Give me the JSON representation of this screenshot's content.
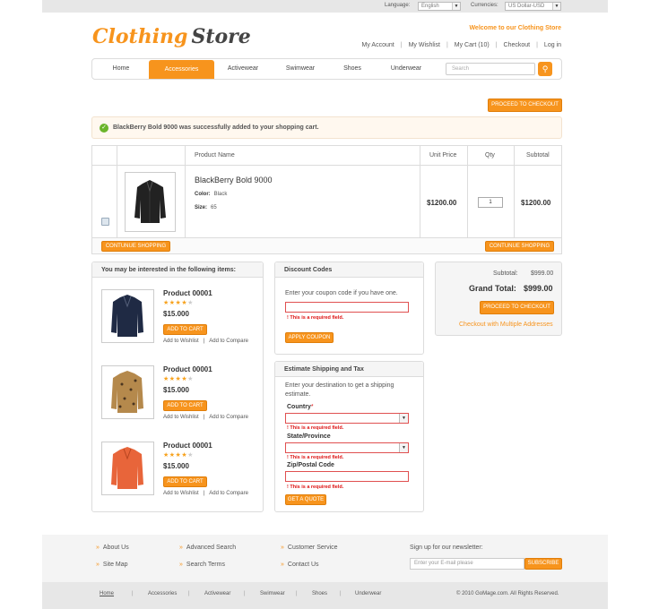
{
  "topbar": {
    "language_label": "Language:",
    "language_value": "English",
    "currency_label": "Currencies:",
    "currency_value": "US Dollar-USD"
  },
  "header": {
    "logo_part1": "Clothing",
    "logo_part2": "Store",
    "welcome": "Welcome to our Clothing Store",
    "links": [
      "My Account",
      "My Wishlist",
      "My Cart (10)",
      "Checkout",
      "Log in"
    ]
  },
  "nav": {
    "items": [
      "Home",
      "Accessories",
      "Activewear",
      "Swimwear",
      "Shoes",
      "Underwear"
    ],
    "active": "Accessories",
    "search_placeholder": "Search"
  },
  "checkout_top_label": "PROCEED TO CHECKOUT",
  "success_message": "BlackBerry Bold 9000 was successfully added to your shopping cart.",
  "cart": {
    "headers": {
      "product": "Product Name",
      "unit_price": "Unit Price",
      "qty": "Qty",
      "subtotal": "Subtotal"
    },
    "item": {
      "name": "BlackBerry Bold 9000",
      "color_label": "Color:",
      "color_value": "Black",
      "size_label": "Size:",
      "size_value": "65",
      "unit_price": "$1200.00",
      "qty": "1",
      "subtotal": "$1200.00"
    },
    "continue_label": "CONTUNUE SHOPPING"
  },
  "crosssell": {
    "title": "You may be interested in the following items:",
    "products": [
      {
        "name": "Product 00001",
        "price": "$15.000",
        "rating": 4,
        "add_to_cart": "ADD TO CART",
        "wishlist": "Add to Wishlist",
        "compare": "Add to Compare"
      },
      {
        "name": "Product 00001",
        "price": "$15.000",
        "rating": 4,
        "add_to_cart": "ADD TO CART",
        "wishlist": "Add to Wishlist",
        "compare": "Add to Compare"
      },
      {
        "name": "Product 00001",
        "price": "$15.000",
        "rating": 4,
        "add_to_cart": "ADD TO CART",
        "wishlist": "Add to Wishlist",
        "compare": "Add to Compare"
      }
    ]
  },
  "discount": {
    "title": "Discount Codes",
    "prompt": "Enter your coupon code if you have one.",
    "error": "This is a required field.",
    "apply_label": "APPLY COUPON"
  },
  "shipping": {
    "title": "Estimate Shipping and Tax",
    "prompt": "Enter your destination to get a shipping estimate.",
    "country_label": "Country",
    "state_label": "State/Province",
    "zip_label": "Zip/Postal Code",
    "error": "This is a required field.",
    "quote_label": "GET A QUOTE"
  },
  "totals": {
    "subtotal_label": "Subtotal:",
    "subtotal_value": "$999.00",
    "grand_label": "Grand Total:",
    "grand_value": "$999.00",
    "checkout_label": "PROCEED TO CHECKOUT",
    "multi_label": "Checkout with Multiple Addresses"
  },
  "footer": {
    "col1": [
      "About Us",
      "Site Map"
    ],
    "col2": [
      "Advanced Search",
      "Search Terms"
    ],
    "col3": [
      "Customer Service",
      "Contact Us"
    ],
    "newsletter_label": "Sign up for our newsletter:",
    "newsletter_placeholder": "Enter your E-mail please",
    "subscribe_label": "SUBSCRIBE"
  },
  "bottom": {
    "links": [
      "Home",
      "Accessories",
      "Activewear",
      "Swimwear",
      "Shoes",
      "Underwear"
    ],
    "copyright": "© 2010 GoMage.com. All Rights Reserved."
  },
  "colors": {
    "accent": "#f7941d",
    "error": "#dd1111",
    "success": "#6bb52b"
  }
}
